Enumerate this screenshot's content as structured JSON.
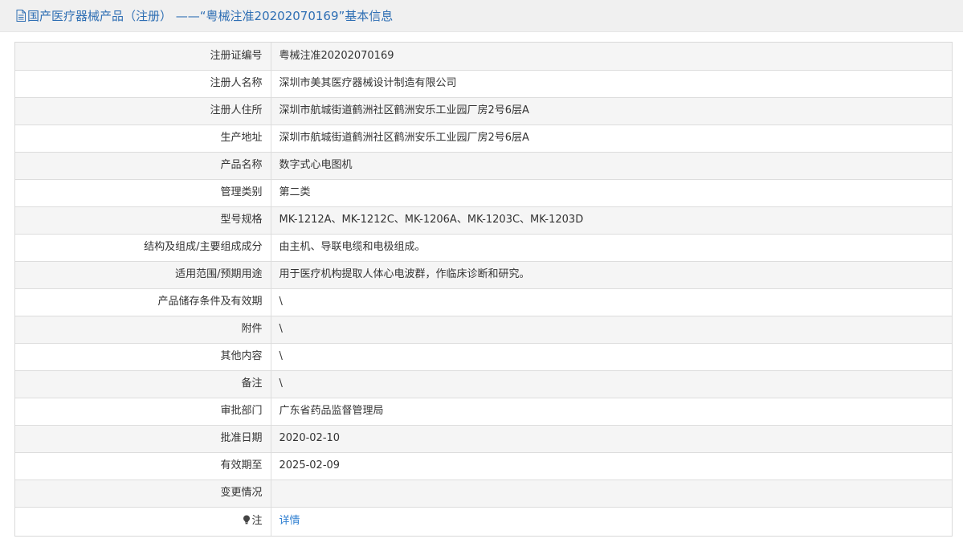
{
  "header": {
    "title": "国产医疗器械产品（注册） ——“粤械注准20202070169”基本信息"
  },
  "rows": [
    {
      "label": "注册证编号",
      "value": "粤械注准20202070169"
    },
    {
      "label": "注册人名称",
      "value": "深圳市美其医疗器械设计制造有限公司"
    },
    {
      "label": "注册人住所",
      "value": "深圳市航城街道鹤洲社区鹤洲安乐工业园厂房2号6层A"
    },
    {
      "label": "生产地址",
      "value": "深圳市航城街道鹤洲社区鹤洲安乐工业园厂房2号6层A"
    },
    {
      "label": "产品名称",
      "value": "数字式心电图机"
    },
    {
      "label": "管理类别",
      "value": "第二类"
    },
    {
      "label": "型号规格",
      "value": "MK-1212A、MK-1212C、MK-1206A、MK-1203C、MK-1203D"
    },
    {
      "label": "结构及组成/主要组成成分",
      "value": "由主机、导联电缆和电极组成。"
    },
    {
      "label": "适用范围/预期用途",
      "value": "用于医疗机构提取人体心电波群，作临床诊断和研究。"
    },
    {
      "label": "产品储存条件及有效期",
      "value": "\\"
    },
    {
      "label": "附件",
      "value": "\\"
    },
    {
      "label": "其他内容",
      "value": "\\"
    },
    {
      "label": "备注",
      "value": "\\"
    },
    {
      "label": "审批部门",
      "value": "广东省药品监督管理局"
    },
    {
      "label": "批准日期",
      "value": "2020-02-10"
    },
    {
      "label": "有效期至",
      "value": "2025-02-09"
    },
    {
      "label": "变更情况",
      "value": ""
    }
  ],
  "note": {
    "label": "注",
    "link_text": "详情",
    "icon": "lightbulb-icon"
  },
  "colors": {
    "title": "#2f6fb4",
    "link": "#2f7fd1",
    "header_bg": "#f0f0f0",
    "stripe": "#f5f5f5",
    "border": "#dddddd"
  }
}
